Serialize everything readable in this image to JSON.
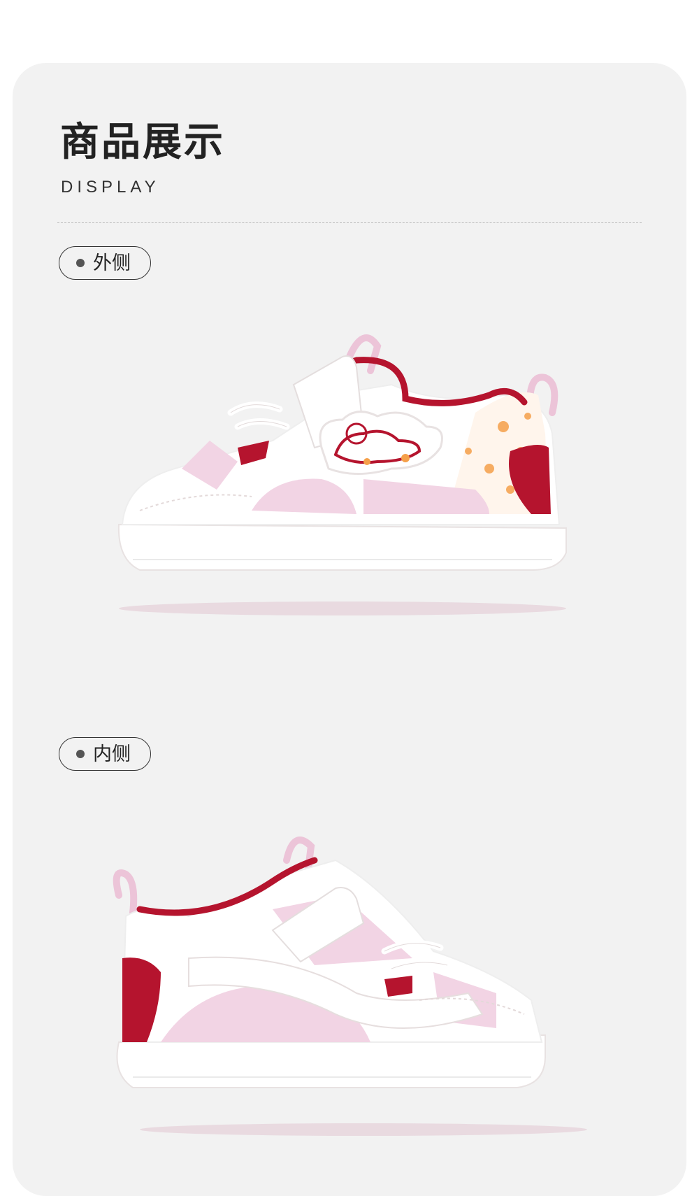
{
  "section": {
    "title": "商品展示",
    "subtitle": "DISPLAY"
  },
  "views": [
    {
      "label": "外侧"
    },
    {
      "label": "内侧"
    }
  ],
  "colors": {
    "background": "#f2f2f2",
    "accent_red": "#b5142e",
    "shoe_pink": "#f2d4e4",
    "shoe_white": "#ffffff",
    "orange_print": "#f5a04a"
  }
}
